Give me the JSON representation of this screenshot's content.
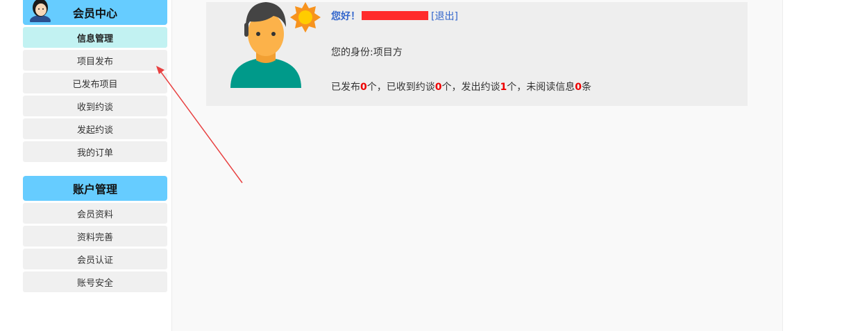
{
  "sidebar": {
    "member_center": {
      "title": "会员中心",
      "items": [
        "信息管理",
        "项目发布",
        "已发布项目",
        "收到约谈",
        "发起约谈",
        "我的订单"
      ]
    },
    "account": {
      "title": "账户管理",
      "items": [
        "会员资料",
        "资料完善",
        "会员认证",
        "账号安全"
      ]
    }
  },
  "profile": {
    "greeting": "您好！",
    "logout": "[退出]",
    "identity": "您的身份:项目方",
    "stats": {
      "published_label": "已发布",
      "published": "0",
      "unit_ge": "个",
      "received_label": "，已收到约谈",
      "received": "0",
      "sent_label": "，发出约谈",
      "sent": "1",
      "unread_label": "，未阅读信息",
      "unread": "0",
      "unit_tiao": "条"
    }
  },
  "colors": {
    "header_blue": "#66ccff",
    "active_item": "#c2f2f2",
    "link_blue": "#3366cc",
    "count_red": "#ee0000",
    "annotation_arrow": "#e84040"
  }
}
